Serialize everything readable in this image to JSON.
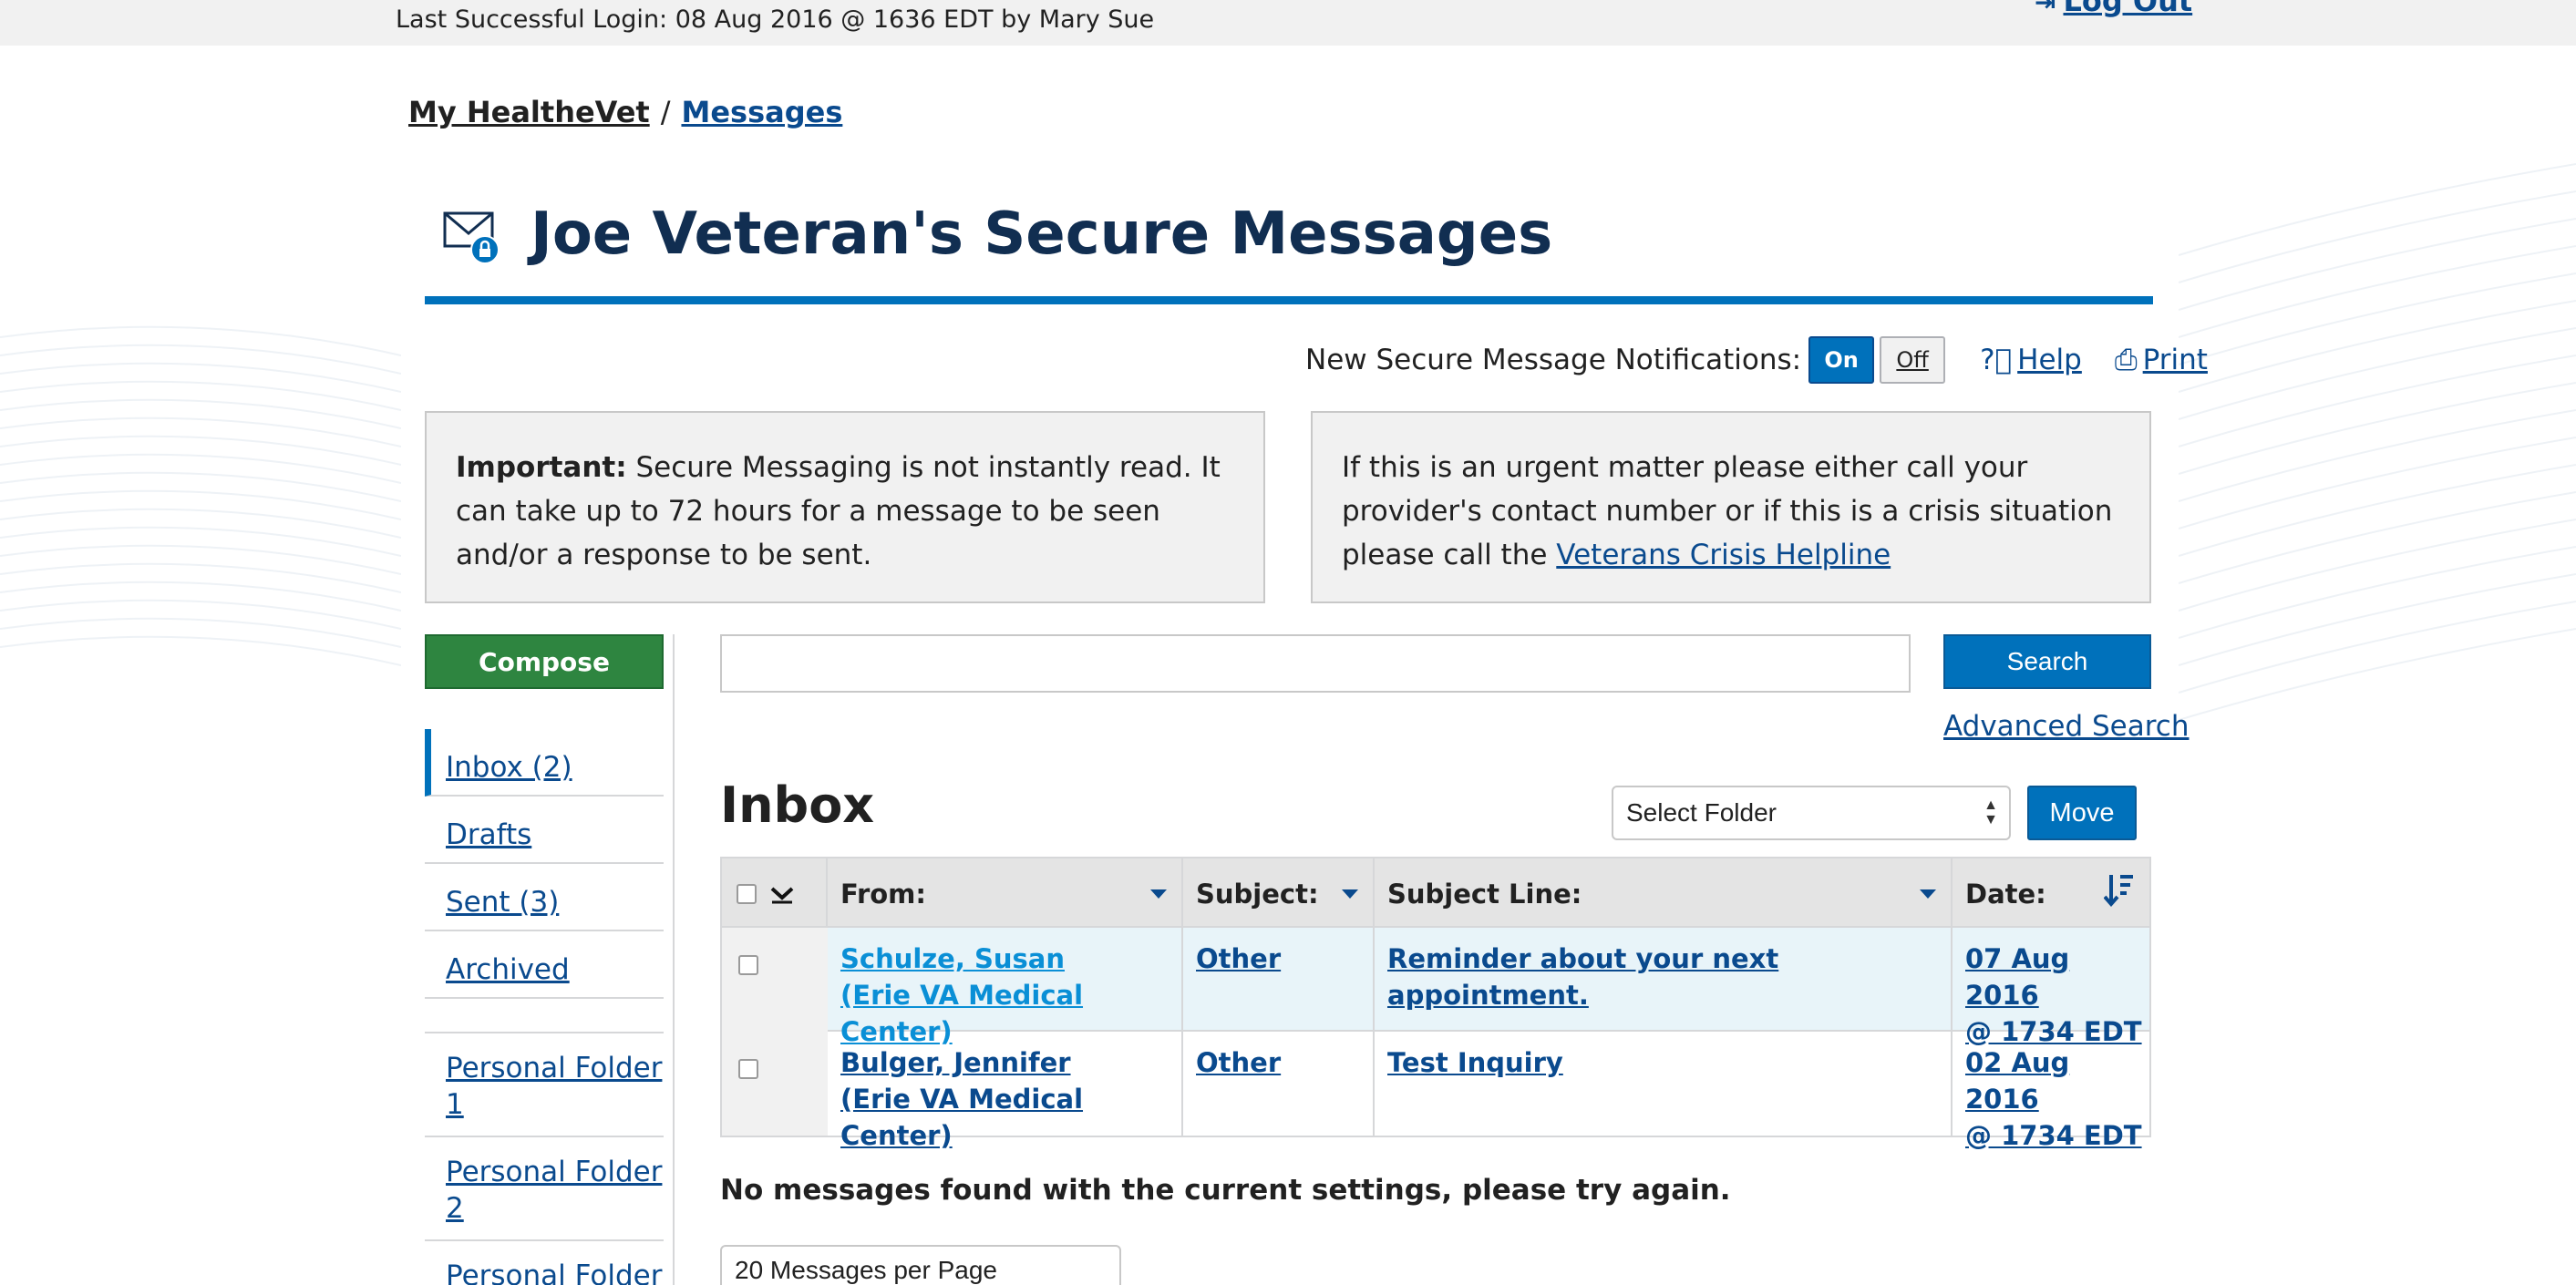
{
  "header": {
    "last_login": "Last Successful Login: 08 Aug 2016 @ 1636 EDT by Mary Sue",
    "logout_label": "Log Out"
  },
  "breadcrumb": {
    "home": "My HealtheVet",
    "separator": "/",
    "current": "Messages"
  },
  "page": {
    "title": "Joe Veteran's Secure Messages"
  },
  "notifications": {
    "label": "New Secure Message Notifications:",
    "on_label": "On",
    "off_label": "Off",
    "selected": "On",
    "help_label": "Help",
    "print_label": "Print"
  },
  "info": {
    "important_prefix": "Important:",
    "important_text": " Secure Messaging is not instantly read. It can take up to 72 hours for a message to be seen and/or a response to be sent.",
    "urgent_text": "If this is an urgent matter please either call your provider's contact number or if this is a crisis situation please call the ",
    "crisis_link": "Veterans Crisis Helpline"
  },
  "compose_label": "Compose",
  "sidebar": {
    "folders": [
      {
        "label": "Inbox (2)"
      },
      {
        "label": "Drafts"
      },
      {
        "label": "Sent (3)"
      },
      {
        "label": "Archived"
      }
    ],
    "personal_folders": [
      {
        "label": "Personal Folder 1"
      },
      {
        "label": "Personal Folder 2"
      },
      {
        "label": "Personal Folder"
      }
    ]
  },
  "search": {
    "value": "",
    "placeholder": "",
    "button_label": "Search",
    "advanced_label": "Advanced Search"
  },
  "inbox": {
    "title": "Inbox",
    "folder_select": "Select Folder",
    "move_label": "Move"
  },
  "table": {
    "headers": {
      "from": "From:",
      "subject": "Subject:",
      "subject_line": "Subject Line:",
      "date": "Date:"
    },
    "rows": [
      {
        "from_name": "Schulze, Susan",
        "from_org": "(Erie VA Medical Center)",
        "subject": "Other",
        "subject_line": "Reminder about your next appointment.",
        "date_line1": "07 Aug 2016",
        "date_line2": "@ 1734 EDT",
        "unread": true
      },
      {
        "from_name": "Bulger, Jennifer",
        "from_org": "(Erie VA Medical Center)",
        "subject": "Other",
        "subject_line": "Test Inquiry",
        "date_line1": "02 Aug 2016",
        "date_line2": "@ 1734 EDT",
        "unread": false
      }
    ]
  },
  "no_messages": "No messages found with the current settings, please try again.",
  "per_page": "20 Messages per Page",
  "colors": {
    "primary_blue": "#0071bb",
    "link_blue": "#0a4a8e",
    "title_navy": "#112e51",
    "compose_green": "#2e8540",
    "unread_row": "#e8f4f9"
  }
}
